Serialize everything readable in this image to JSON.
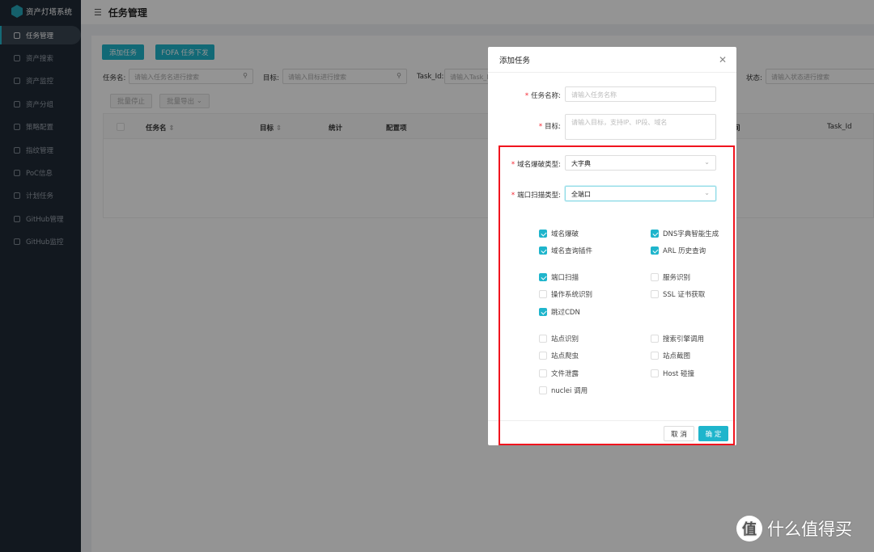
{
  "app": {
    "name": "资产灯塔系统"
  },
  "sidebar": {
    "items": [
      {
        "label": "任务管理",
        "active": true
      },
      {
        "label": "资产搜索"
      },
      {
        "label": "资产监控"
      },
      {
        "label": "资产分组"
      },
      {
        "label": "策略配置"
      },
      {
        "label": "指纹管理"
      },
      {
        "label": "PoC信息"
      },
      {
        "label": "计划任务"
      },
      {
        "label": "GitHub管理"
      },
      {
        "label": "GitHub监控"
      }
    ]
  },
  "header": {
    "title": "任务管理"
  },
  "toolbar": {
    "add_task": "添加任务",
    "fofa_task": "FOFA 任务下发",
    "batch_stop": "批量停止",
    "batch_export": "批量导出"
  },
  "filters": [
    {
      "label": "任务名:",
      "placeholder": "请输入任务名进行搜索"
    },
    {
      "label": "目标:",
      "placeholder": "请输入目标进行搜索"
    },
    {
      "label": "Task_Id:",
      "placeholder": "请输入Task_Id进行搜索"
    },
    {
      "label": "状态:",
      "placeholder": "请输入状态进行搜索"
    }
  ],
  "table": {
    "columns": [
      "任务名",
      "目标",
      "统计",
      "配置项",
      "间",
      "Task_Id"
    ]
  },
  "modal": {
    "title": "添加任务",
    "fields": {
      "task_name": {
        "label": "任务名称:",
        "placeholder": "请输入任务名称"
      },
      "target": {
        "label": "目标:",
        "placeholder": "请输入目标，支持IP、IP段、域名"
      },
      "domain_brute_type": {
        "label": "域名爆破类型:",
        "value": "大字典"
      },
      "port_scan_type": {
        "label": "端口扫描类型:",
        "value": "全端口"
      }
    },
    "options": [
      {
        "label": "域名爆破",
        "checked": true
      },
      {
        "label": "DNS字典智能生成",
        "checked": true
      },
      {
        "label": "域名查询插件",
        "checked": true
      },
      {
        "label": "ARL 历史查询",
        "checked": true
      },
      {
        "label": "端口扫描",
        "checked": true
      },
      {
        "label": "服务识别",
        "checked": false
      },
      {
        "label": "操作系统识别",
        "checked": false
      },
      {
        "label": "SSL 证书获取",
        "checked": false
      },
      {
        "label": "跳过CDN",
        "checked": true
      },
      {
        "label": "站点识别",
        "checked": false
      },
      {
        "label": "搜索引擎调用",
        "checked": false
      },
      {
        "label": "站点爬虫",
        "checked": false
      },
      {
        "label": "站点截图",
        "checked": false
      },
      {
        "label": "文件泄露",
        "checked": false
      },
      {
        "label": "Host 碰撞",
        "checked": false
      },
      {
        "label": "nuclei 调用",
        "checked": false
      }
    ],
    "cancel": "取 消",
    "confirm": "确 定"
  },
  "watermark": {
    "icon_text": "值",
    "text": "什么值得买"
  },
  "colors": {
    "accent": "#1fb5cc",
    "highlight_border": "#f0141e",
    "sidebar": "#1f2a36"
  }
}
